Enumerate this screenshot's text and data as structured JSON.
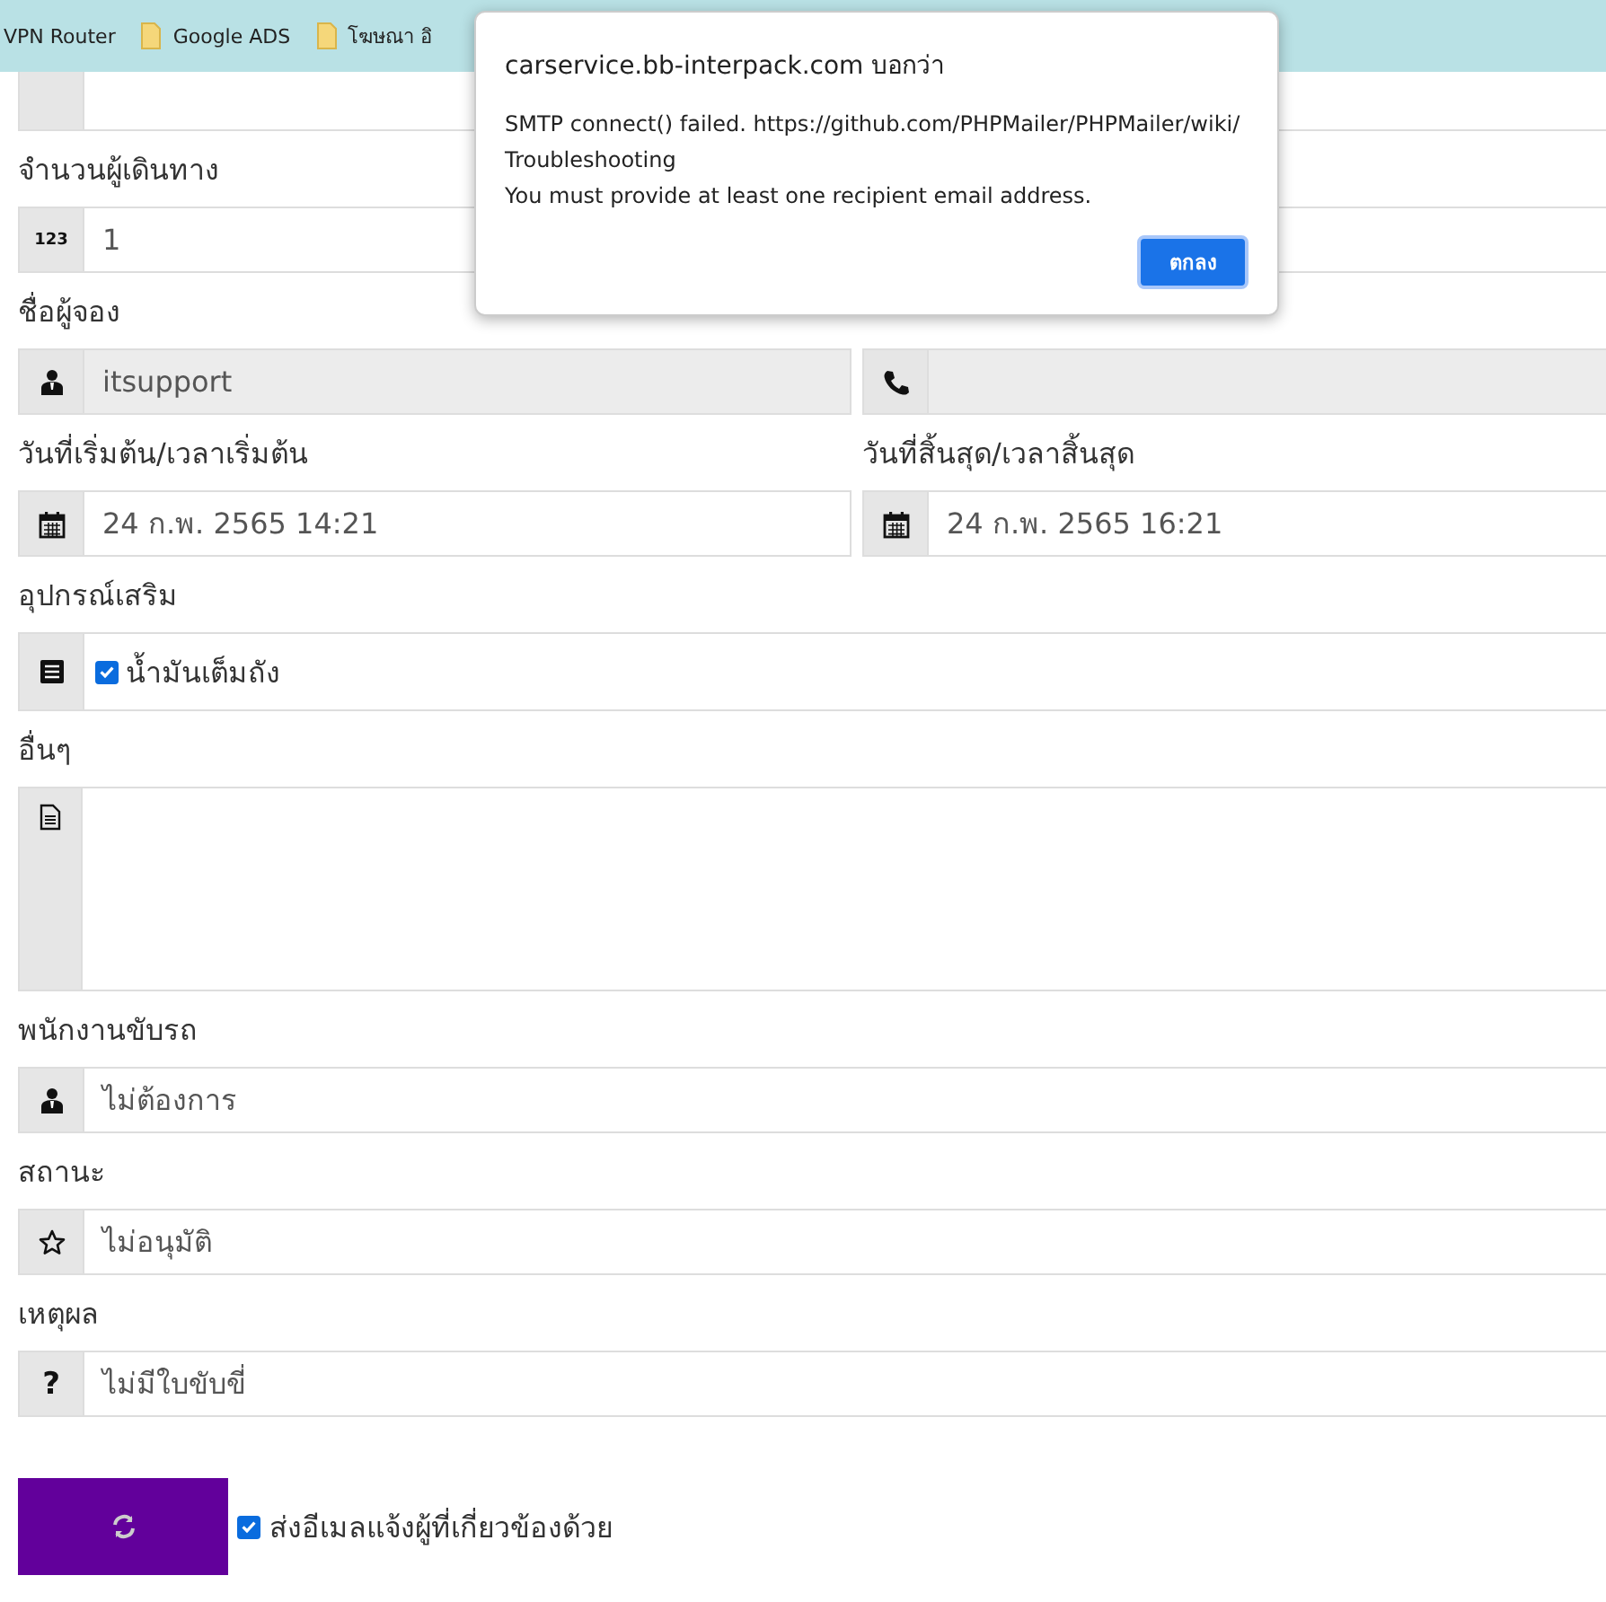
{
  "bookmarks": [
    {
      "label": "VPN Router",
      "folder": false
    },
    {
      "label": "Google ADS",
      "folder": true
    },
    {
      "label": "โฆษณา อิ",
      "folder": true
    }
  ],
  "form_rows": [
    {
      "fields": [
        {
          "kind": "text"
        }
      ]
    },
    {
      "fields": [
        {
          "label": "จำนวนผู้เดินทาง",
          "kind": "text",
          "icon_text": "123",
          "value": "1"
        }
      ]
    },
    {
      "fields": [
        {
          "label": "ชื่อผู้จอง",
          "kind": "text",
          "value": "itsupport",
          "readonly": true
        },
        {
          "kind": "text",
          "readonly": true
        }
      ]
    },
    {
      "fields": [
        {
          "label": "วันที่เริ่มต้น/เวลาเริ่มต้น",
          "kind": "text",
          "value": "24 ก.พ. 2565 14:21",
          "readonly": false
        },
        {
          "label": "วันที่สิ้นสุด/เวลาสิ้นสุด",
          "kind": "text",
          "value": "24 ก.พ. 2565 16:21",
          "readonly": false
        }
      ]
    },
    {
      "fields": [
        {
          "label": "อุปกรณ์เสริม",
          "kind": "checkbox",
          "option": {
            "label": "น้ำมันเต็มถัง",
            "checked": true
          }
        }
      ]
    },
    {
      "fields": [
        {
          "label": "อื่นๆ",
          "kind": "textarea"
        }
      ]
    },
    {
      "fields": [
        {
          "label": "พนักงานขับรถ",
          "kind": "text",
          "value": "ไม่ต้องการ",
          "readonly": false
        }
      ]
    },
    {
      "fields": [
        {
          "label": "สถานะ",
          "kind": "text",
          "value": "ไม่อนุมัติ",
          "readonly": false
        }
      ]
    },
    {
      "fields": [
        {
          "label": "เหตุผล",
          "kind": "text",
          "icon_text": "?",
          "value": "ไม่มีใบขับขี่",
          "readonly": false
        }
      ]
    }
  ],
  "submit": {
    "notify": {
      "label": "ส่งอีเมลแจ้งผู้ที่เกี่ยวข้องด้วย",
      "checked": true
    }
  },
  "dialog": {
    "title": "carservice.bb-interpack.com บอกว่า",
    "message": [
      "SMTP connect() failed. https://github.com/PHPMailer/PHPMailer/wiki/",
      "Troubleshooting",
      "You must provide at least one recipient email address."
    ],
    "button": "ตกลง"
  }
}
